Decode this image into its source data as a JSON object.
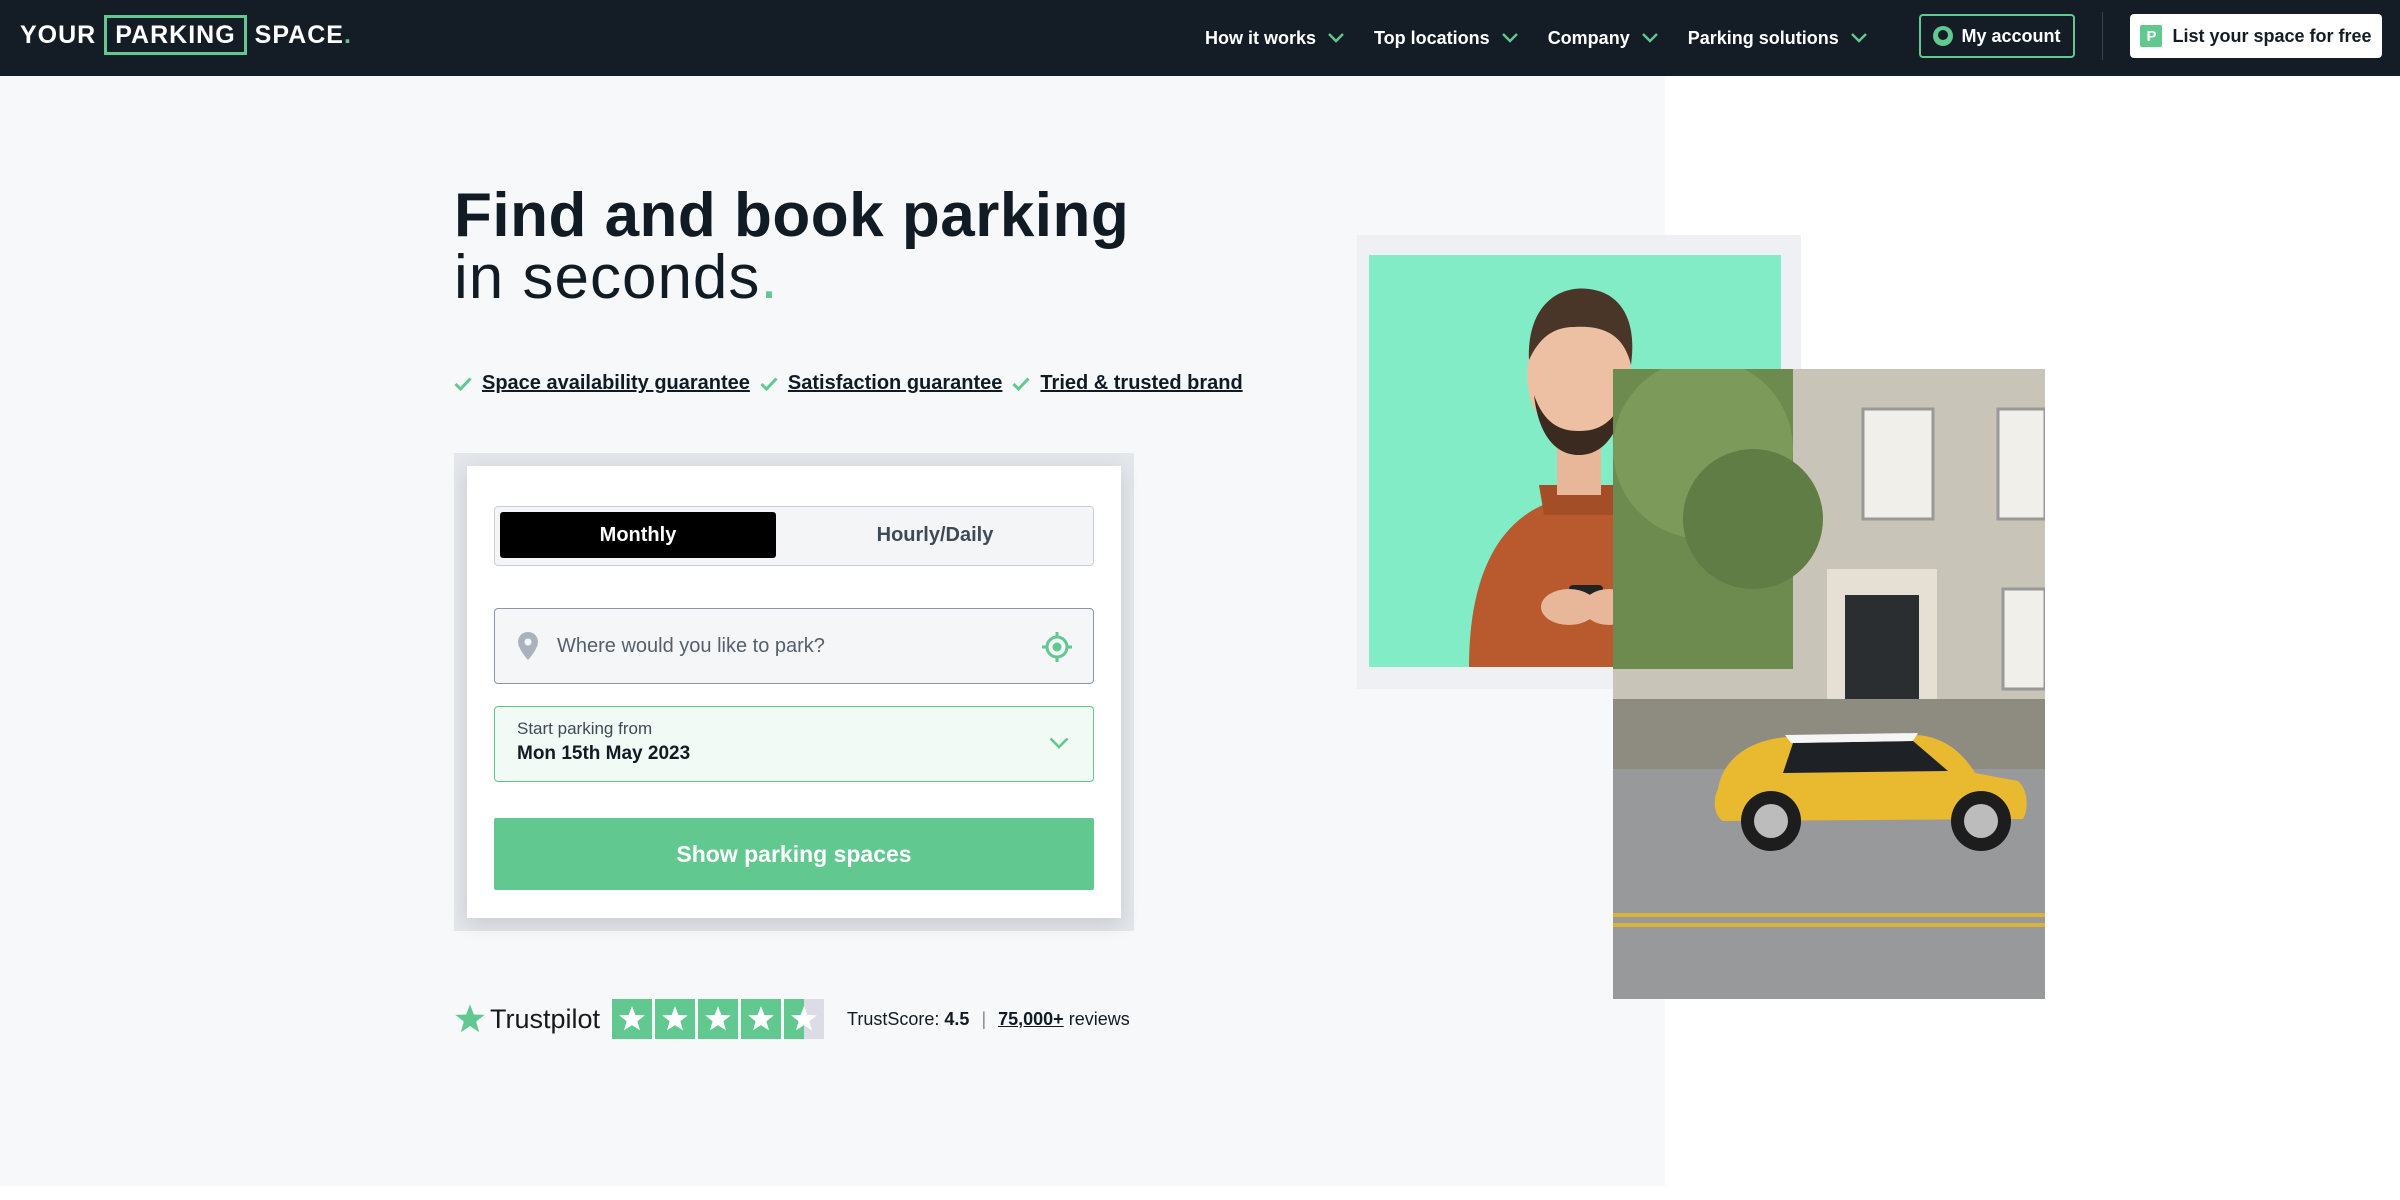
{
  "header": {
    "logo_left": "YOUR",
    "logo_box": "PARKING",
    "logo_right": "SPACE",
    "logo_dot": ".",
    "nav": [
      {
        "label": "How it works"
      },
      {
        "label": "Top locations"
      },
      {
        "label": "Company"
      },
      {
        "label": "Parking solutions"
      }
    ],
    "account_label": "My account",
    "list_label": "List your space for free",
    "list_badge": "P"
  },
  "hero": {
    "title_line1": "Find and book parking",
    "title_line2": "in seconds",
    "title_dot": ".",
    "guarantees": [
      "Space availability guarantee",
      "Satisfaction guarantee",
      "Tried & trusted brand"
    ]
  },
  "search": {
    "tabs": [
      "Monthly",
      "Hourly/Daily"
    ],
    "active_tab": "Monthly",
    "location_placeholder": "Where would you like to park?",
    "location_value": "",
    "date_label": "Start parking from",
    "date_value": "Mon 15th May 2023",
    "submit_label": "Show parking spaces"
  },
  "trustpilot": {
    "brand": "Trustpilot",
    "rating": 4.5,
    "score_label": "TrustScore:",
    "score_value": "4.5",
    "reviews_count": "75,000+",
    "reviews_word": "reviews"
  },
  "colors": {
    "accent": "#61c890",
    "header_bg": "#141c25",
    "hero_bg": "#f7f8fa",
    "photo1_bg": "#82ecc6",
    "car": "#e9b930"
  },
  "icons": [
    "chevron-down-icon",
    "user-icon",
    "check-icon",
    "map-pin-icon",
    "locate-icon",
    "star-icon"
  ]
}
